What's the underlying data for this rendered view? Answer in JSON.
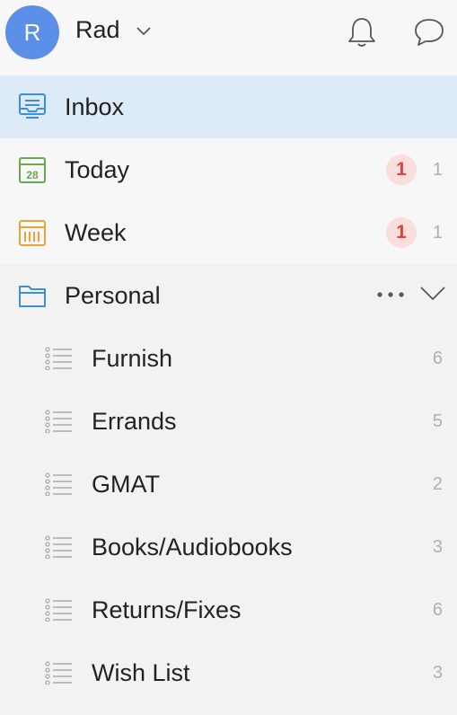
{
  "header": {
    "avatar_letter": "R",
    "user_name": "Rad"
  },
  "smart_lists": [
    {
      "name": "inbox",
      "label": "Inbox"
    },
    {
      "name": "today",
      "label": "Today",
      "icon_text": "28",
      "overdue": "1",
      "count": "1"
    },
    {
      "name": "week",
      "label": "Week",
      "overdue": "1",
      "count": "1"
    }
  ],
  "folder": {
    "label": "Personal"
  },
  "lists": [
    {
      "label": "Furnish",
      "count": "6"
    },
    {
      "label": "Errands",
      "count": "5"
    },
    {
      "label": "GMAT",
      "count": "2"
    },
    {
      "label": "Books/Audiobooks",
      "count": "3"
    },
    {
      "label": "Returns/Fixes",
      "count": "6"
    },
    {
      "label": "Wish List",
      "count": "3"
    }
  ],
  "colors": {
    "accent": "#5b8ee6",
    "selected_bg": "#ddebf8",
    "badge_bg": "#f8dedc",
    "badge_text": "#d9453c",
    "today_green": "#6aa84f",
    "week_orange": "#e8a33a",
    "inbox_blue": "#3d8fd9"
  },
  "icons": {
    "user_menu": "chevron-down-icon",
    "notifications": "bell-icon",
    "messages": "chat-bubble-icon",
    "inbox": "inbox-tray-icon",
    "today": "calendar-day-icon",
    "week": "calendar-week-icon",
    "folder": "folder-icon",
    "list": "list-icon",
    "folder_more": "more-horizontal-icon",
    "folder_collapse": "chevron-down-icon"
  }
}
